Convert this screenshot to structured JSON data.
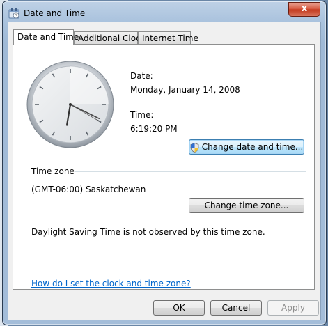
{
  "window": {
    "title": "Date and Time",
    "close_label": "x"
  },
  "tabs": [
    {
      "label": "Date and Time",
      "active": true
    },
    {
      "label": "Additional Clocks",
      "active": false
    },
    {
      "label": "Internet Time",
      "active": false
    }
  ],
  "clock": {
    "hours": 6,
    "minutes": 19,
    "seconds": 20
  },
  "date": {
    "label": "Date:",
    "value": "Monday, January 14, 2008"
  },
  "time": {
    "label": "Time:",
    "value": "6:19:20 PM"
  },
  "change_datetime_label": "Change date and time...",
  "timezone": {
    "header": "Time zone",
    "value": "(GMT-06:00) Saskatchewan",
    "change_label": "Change time zone..."
  },
  "dst_note": "Daylight Saving Time is not observed by this time zone.",
  "help_link": "How do I set the clock and time zone?",
  "footer": {
    "ok": "OK",
    "cancel": "Cancel",
    "apply": "Apply"
  }
}
